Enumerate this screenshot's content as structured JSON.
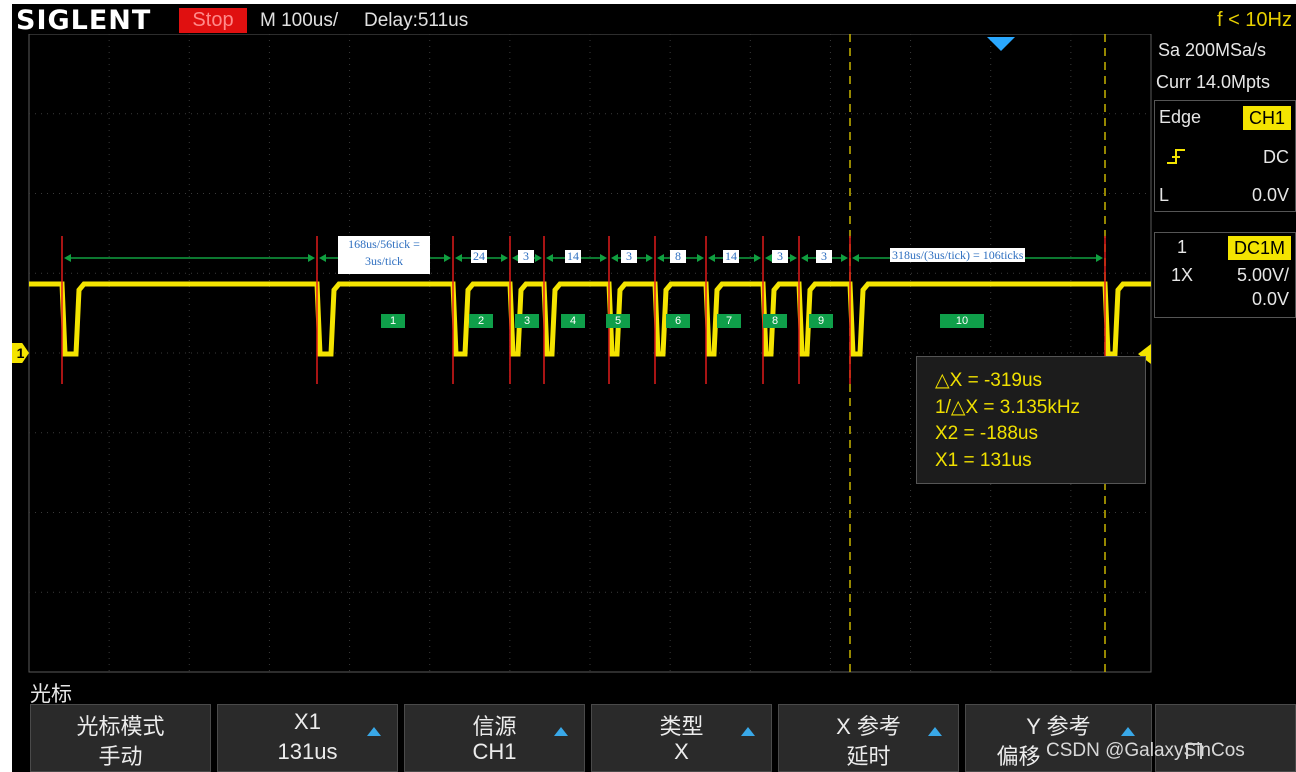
{
  "header": {
    "brand": "SIGLENT",
    "run_state": "Stop",
    "timebase": "M 100us/",
    "delay": "Delay:511us",
    "frequency": "f < 10Hz"
  },
  "acquisition": {
    "sample_rate": "Sa 200MSa/s",
    "memory_depth": "Curr 14.0Mpts"
  },
  "trigger": {
    "type": "Edge",
    "source": "CH1",
    "coupling": "DC",
    "level_prefix": "L",
    "level": "0.0V"
  },
  "channel": {
    "number": "1",
    "coupling": "DC1M",
    "probe": "1X",
    "scale": "5.00V/",
    "offset": "0.0V",
    "marker": "1"
  },
  "annotations": {
    "first_interval": [
      "168us/56tick =",
      "3us/tick"
    ],
    "counts": [
      "24",
      "3",
      "14",
      "3",
      "8",
      "14",
      "3",
      "3"
    ],
    "last_interval": "318us/(3us/tick) = 106ticks",
    "pulse_ids": [
      "1",
      "2",
      "3",
      "4",
      "5",
      "6",
      "7",
      "8",
      "9",
      "10"
    ]
  },
  "measurements": {
    "delta_x": "△X = -319us",
    "inv_delta_x": "1/△X = 3.135kHz",
    "x2": "X2 = -188us",
    "x1": "X1 = 131us"
  },
  "menu": {
    "title": "光标",
    "softkeys": [
      {
        "label": "光标模式",
        "value": "手动"
      },
      {
        "label": "X1",
        "value": "131us"
      },
      {
        "label": "信源",
        "value": "CH1"
      },
      {
        "label": "类型",
        "value": "X"
      },
      {
        "label": "X 参考",
        "value": "延时"
      },
      {
        "label": "Y 参考",
        "value": "偏移"
      }
    ]
  },
  "watermark": "CSDN @GalaxySinCos",
  "colors": {
    "trace": "#f4e400",
    "cursor": "#c8b400",
    "annotation_arrow": "#10a040",
    "edge_marker": "#e01a1a",
    "softkey_arrow": "#39a8e8",
    "stop": "#e01010"
  }
}
